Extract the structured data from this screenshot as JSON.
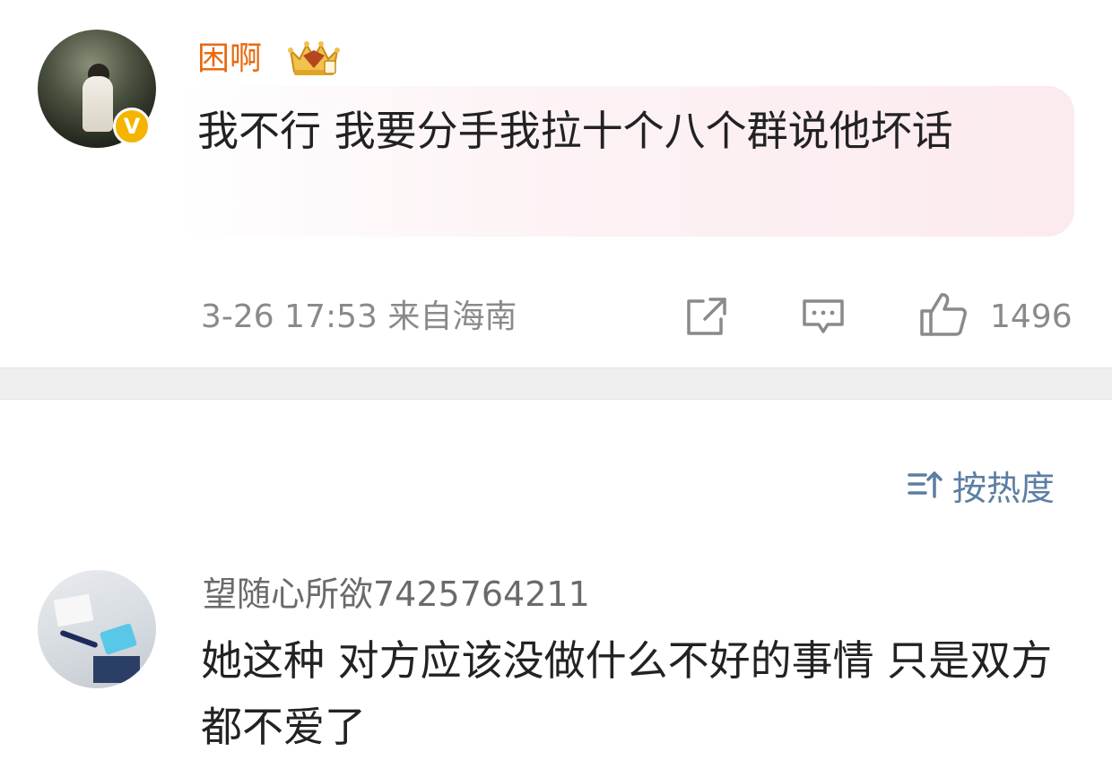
{
  "post": {
    "username": "困啊",
    "verified_badge": "V",
    "crown_icon": "crown-badge-icon",
    "text": "我不行 我要分手我拉十个八个群说他坏话",
    "meta": "3-26 17:53 来自海南",
    "likes": "1496"
  },
  "sort": {
    "label": "按热度"
  },
  "reply": {
    "username": "望随心所欲7425764211",
    "text": "她这种 对方应该没做什么不好的事情 只是双方都不爱了"
  },
  "colors": {
    "username_orange": "#e86a10",
    "badge_yellow": "#f4b400",
    "link_blue": "#5b7ea3",
    "meta_gray": "#8a8a8a",
    "bubble_pink": "#fbeaee"
  }
}
